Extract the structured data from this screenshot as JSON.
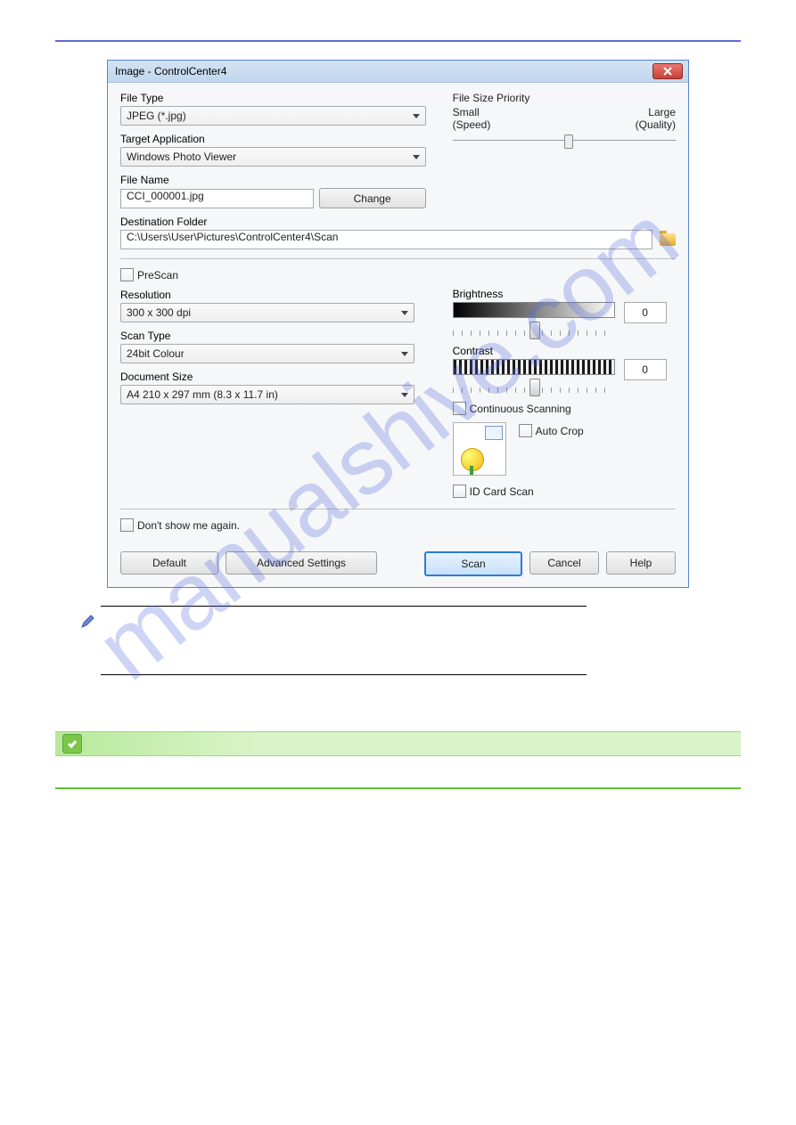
{
  "dialog": {
    "title": "Image - ControlCenter4",
    "fields": {
      "file_type_label": "File Type",
      "file_type_value": "JPEG (*.jpg)",
      "target_app_label": "Target Application",
      "target_app_value": "Windows Photo Viewer",
      "file_name_label": "File Name",
      "file_name_value": "CCI_000001.jpg",
      "change_btn": "Change",
      "dest_folder_label": "Destination Folder",
      "dest_folder_value": "C:\\Users\\User\\Pictures\\ControlCenter4\\Scan",
      "prescan_label": "PreScan",
      "resolution_label": "Resolution",
      "resolution_value": "300 x 300 dpi",
      "scan_type_label": "Scan Type",
      "scan_type_value": "24bit Colour",
      "doc_size_label": "Document Size",
      "doc_size_value": "A4 210 x 297 mm (8.3 x 11.7 in)"
    },
    "right": {
      "filesize_priority_label": "File Size Priority",
      "filesize_small": "Small",
      "filesize_large": "Large",
      "filesize_speed": "(Speed)",
      "filesize_quality": "(Quality)",
      "brightness_label": "Brightness",
      "brightness_value": "0",
      "contrast_label": "Contrast",
      "contrast_value": "0",
      "continuous_label": "Continuous Scanning",
      "autocrop_label": "Auto Crop",
      "idcard_label": "ID Card Scan"
    },
    "footer": {
      "dont_show": "Don't show me again.",
      "default_btn": "Default",
      "advanced_btn": "Advanced Settings",
      "scan_btn": "Scan",
      "cancel_btn": "Cancel",
      "help_btn": "Help"
    }
  }
}
